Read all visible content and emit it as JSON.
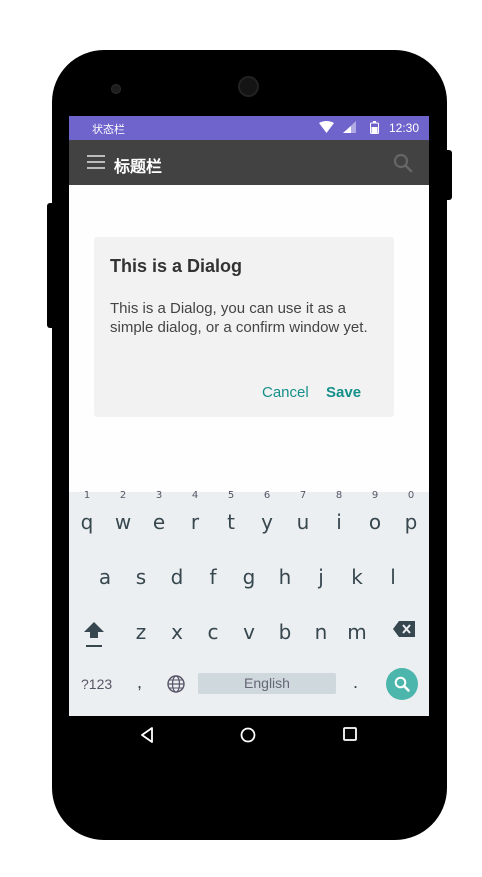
{
  "status_bar": {
    "label": "状态栏",
    "time": "12:30",
    "icons": [
      "wifi-icon",
      "cellular-signal-icon",
      "battery-icon"
    ],
    "color": "#6f63cc"
  },
  "title_bar": {
    "title": "标题栏",
    "icons": [
      "menu-icon",
      "search-icon"
    ],
    "color": "#424242"
  },
  "dialog": {
    "title": "This is a Dialog",
    "body": "This is a Dialog, you can use it as a simple dialog, or a confirm window yet.",
    "cancel_label": "Cancel",
    "save_label": "Save",
    "accent": "#14908a"
  },
  "keyboard": {
    "row1": [
      {
        "ch": "q",
        "hint": "1"
      },
      {
        "ch": "w",
        "hint": "2"
      },
      {
        "ch": "e",
        "hint": "3"
      },
      {
        "ch": "r",
        "hint": "4"
      },
      {
        "ch": "t",
        "hint": "5"
      },
      {
        "ch": "y",
        "hint": "6"
      },
      {
        "ch": "u",
        "hint": "7"
      },
      {
        "ch": "i",
        "hint": "8"
      },
      {
        "ch": "o",
        "hint": "9"
      },
      {
        "ch": "p",
        "hint": "0"
      }
    ],
    "row2": [
      "a",
      "s",
      "d",
      "f",
      "g",
      "h",
      "j",
      "k",
      "l"
    ],
    "row3": [
      "z",
      "x",
      "c",
      "v",
      "b",
      "n",
      "m"
    ],
    "mode_label": "?123",
    "comma": ",",
    "space_label": "English",
    "period": ".",
    "icons": [
      "shift-icon",
      "backspace-icon",
      "globe-icon",
      "search-icon"
    ]
  },
  "nav_bar": {
    "icons": [
      "back-icon",
      "home-icon",
      "recents-icon"
    ]
  }
}
